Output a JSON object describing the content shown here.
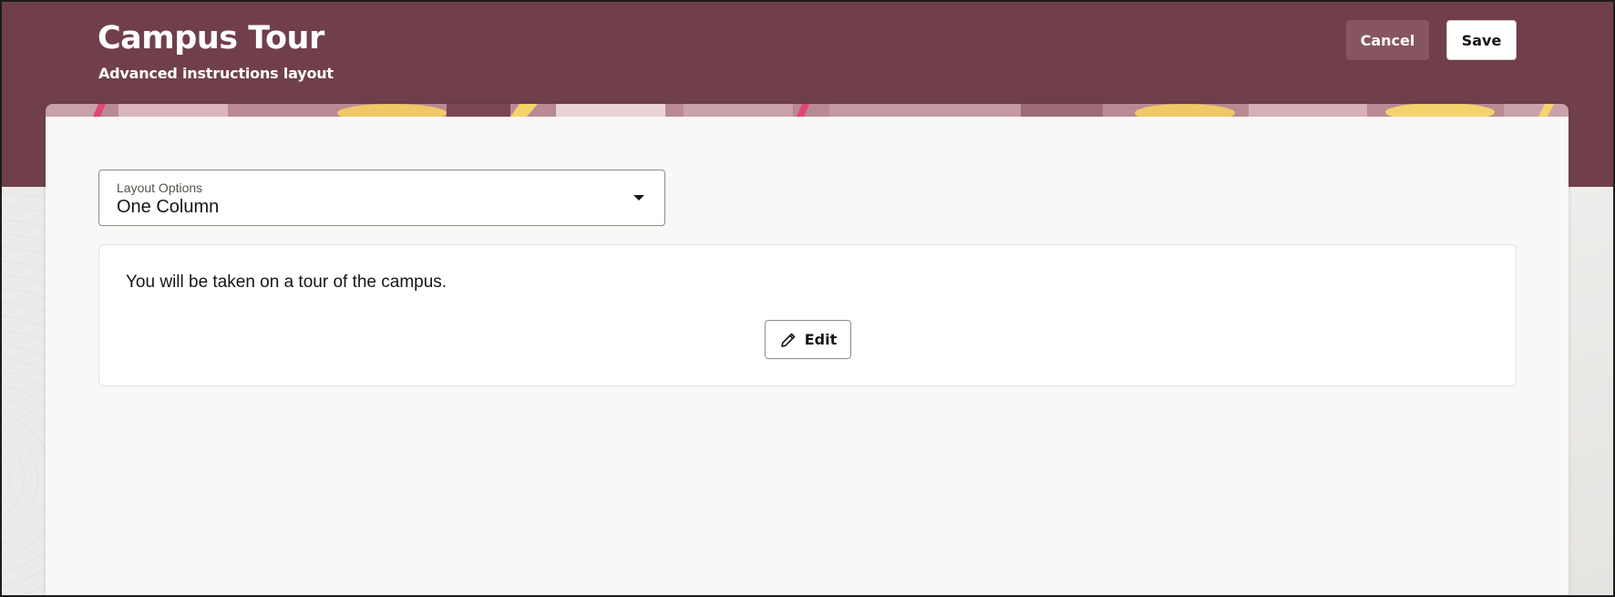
{
  "header": {
    "title": "Campus Tour",
    "subtitle": "Advanced instructions layout",
    "cancel_label": "Cancel",
    "save_label": "Save"
  },
  "layout_options": {
    "label": "Layout Options",
    "selected": "One Column",
    "icon": "chevron-down-icon"
  },
  "instructions": {
    "text": "You will be taken on a tour of the campus.",
    "edit_label": "Edit",
    "edit_icon": "pencil-icon"
  },
  "colors": {
    "header_bg": "#703f4b",
    "cancel_bg": "#86555f",
    "card_bg": "#f9f8f6"
  }
}
